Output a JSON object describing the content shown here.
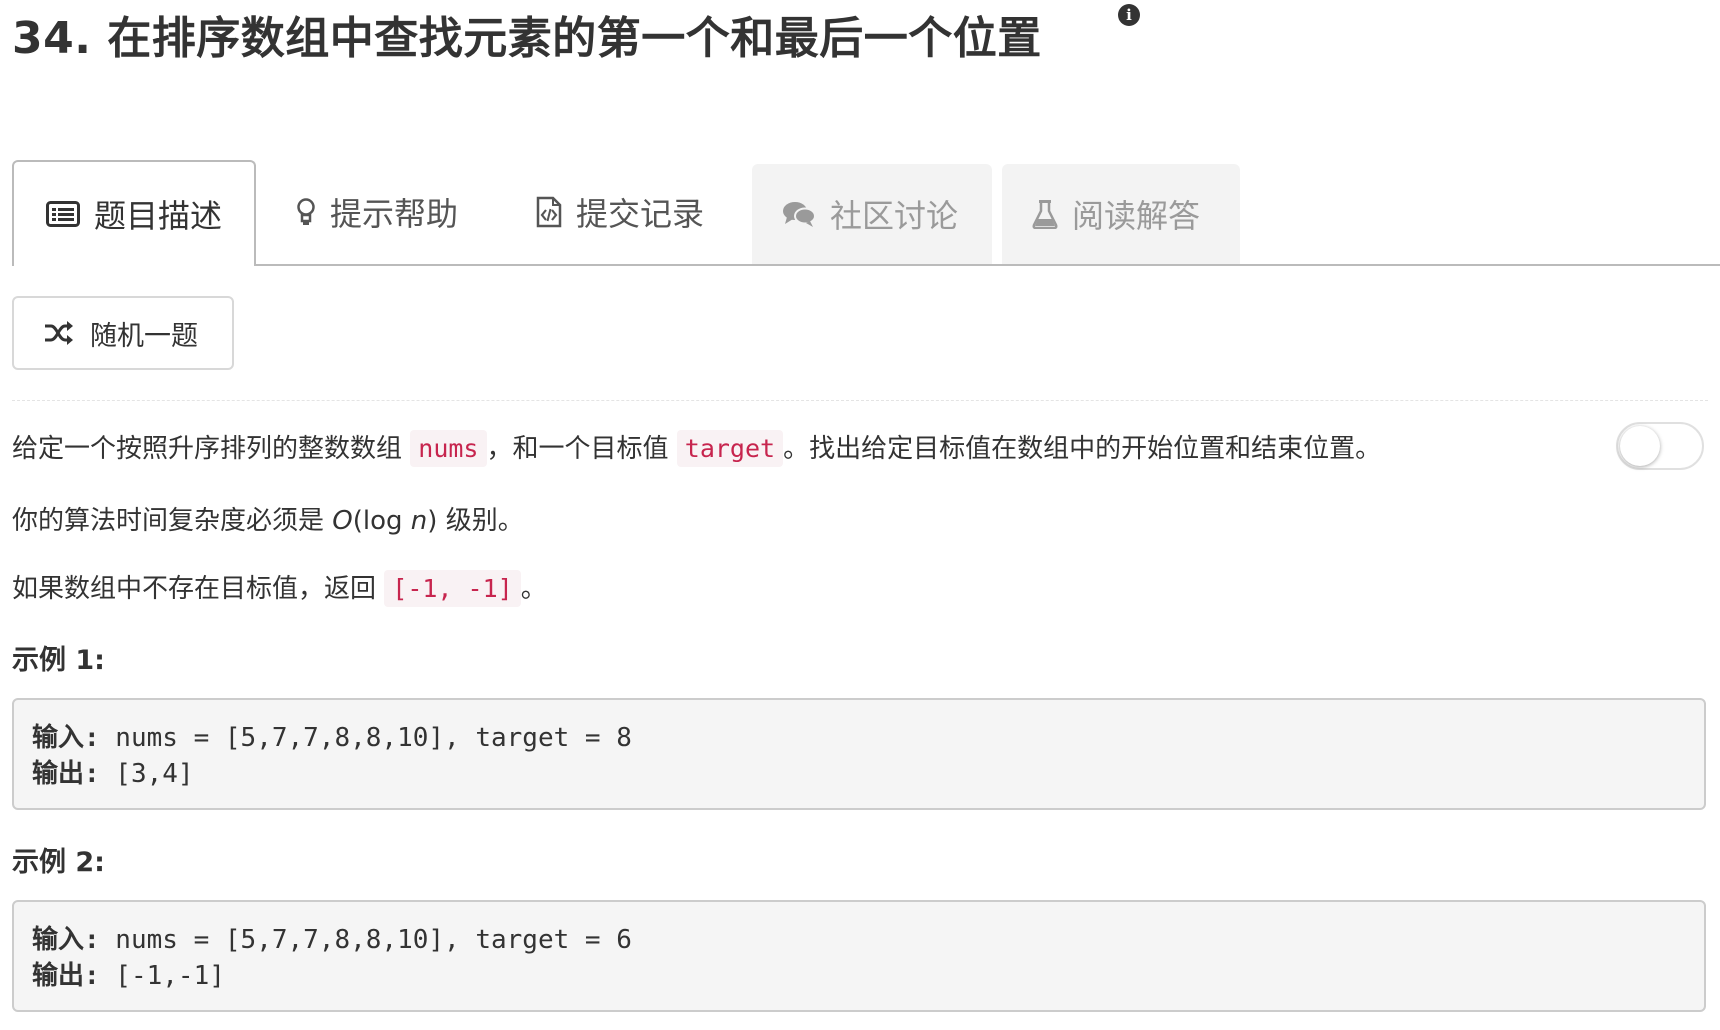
{
  "problem": {
    "title": "34. 在排序数组中查找元素的第一个和最后一个位置",
    "info_glyph": "i"
  },
  "tabs": [
    {
      "label": "题目描述",
      "icon": "list-icon",
      "state": "active"
    },
    {
      "label": "提示帮助",
      "icon": "lightbulb-icon",
      "state": "normal"
    },
    {
      "label": "提交记录",
      "icon": "file-code-icon",
      "state": "normal"
    },
    {
      "label": "社区讨论",
      "icon": "comments-icon",
      "state": "disabled"
    },
    {
      "label": "阅读解答",
      "icon": "flask-icon",
      "state": "disabled"
    }
  ],
  "random_button": {
    "label": "随机一题",
    "icon": "shuffle-icon"
  },
  "description": {
    "p1_part1": "给定一个按照升序排列的整数数组",
    "p1_code1": "nums",
    "p1_part2": "，和一个目标值",
    "p1_code2": "target",
    "p1_part3": "。找出给定目标值在数组中的开始位置和结束位置。",
    "p2_part1": "你的算法时间复杂度必须是",
    "p2_O": "O",
    "p2_paren_open": "(log ",
    "p2_n": "n",
    "p2_paren_close": ")",
    "p2_part2": "级别。",
    "p3_part1": "如果数组中不存在目标值，返回",
    "p3_code": "[-1, -1]",
    "p3_part2": "。"
  },
  "toggle": {
    "state": "off"
  },
  "examples": [
    {
      "heading": "示例 1:",
      "input_label": "输入:",
      "input_value": " nums = [5,7,7,8,8,10], target = 8",
      "output_label": "输出:",
      "output_value": " [3,4]"
    },
    {
      "heading": "示例 2:",
      "input_label": "输入:",
      "input_value": " nums = [5,7,7,8,8,10], target = 6",
      "output_label": "输出:",
      "output_value": " [-1,-1]"
    }
  ],
  "colors": {
    "code_text": "#c7254e",
    "code_bg": "#f9f2f4",
    "disabled_tab_bg": "#f3f3f3",
    "pre_bg": "#f5f5f5"
  }
}
